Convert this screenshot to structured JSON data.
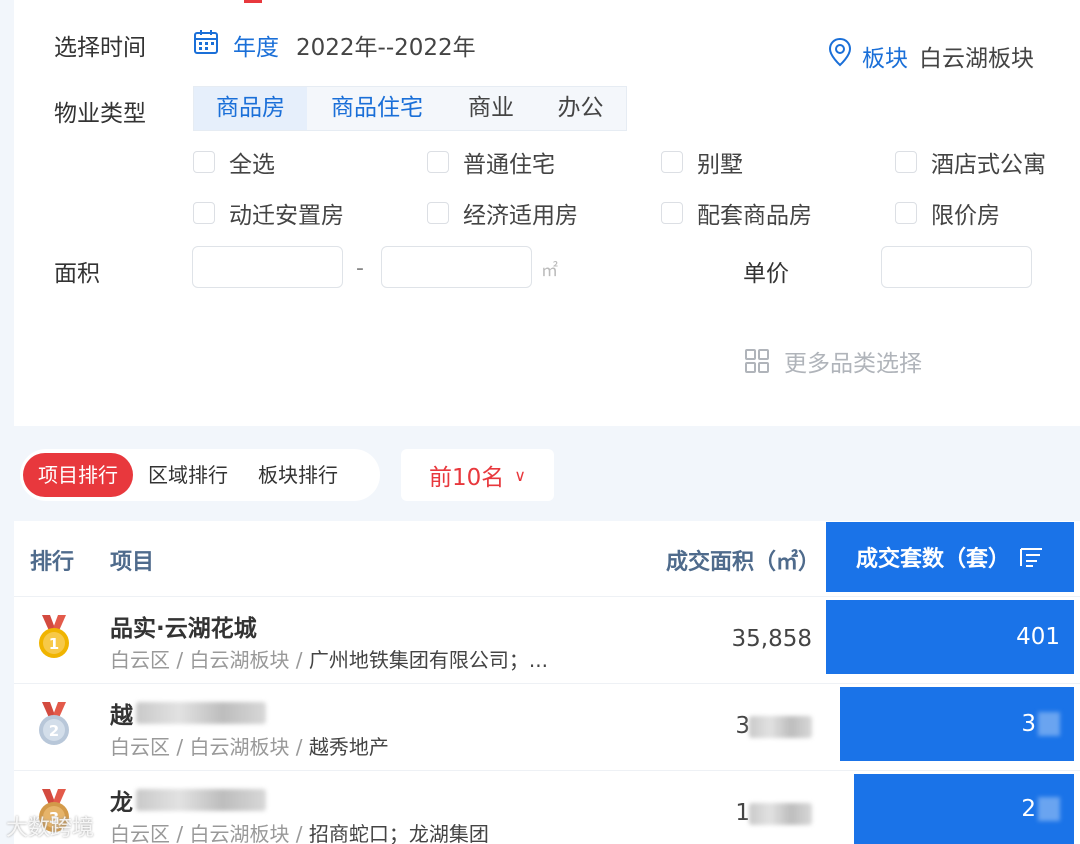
{
  "filters": {
    "time_label": "选择时间",
    "time_mode": "年度",
    "time_range": "2022年--2022年",
    "location_label": "板块",
    "location_value": "白云湖板块",
    "property_type_label": "物业类型",
    "property_tabs": [
      {
        "label": "商品房",
        "active": true
      },
      {
        "label": "商品住宅",
        "active": false
      },
      {
        "label": "商业",
        "active": false
      },
      {
        "label": "办公",
        "active": false
      }
    ],
    "checkboxes": [
      "全选",
      "普通住宅",
      "别墅",
      "酒店式公寓",
      "动迁安置房",
      "经济适用房",
      "配套商品房",
      "限价房"
    ],
    "area_label": "面积",
    "area_min": "",
    "area_max": "",
    "area_separator": "-",
    "area_unit": "㎡",
    "price_label": "单价",
    "price_value": "",
    "more_categories": "更多品类选择"
  },
  "ranking": {
    "tabs": [
      {
        "label": "项目排行",
        "active": true
      },
      {
        "label": "区域排行",
        "active": false
      },
      {
        "label": "板块排行",
        "active": false
      }
    ],
    "top_n": "前10名"
  },
  "table": {
    "headers": {
      "rank": "排行",
      "project": "项目",
      "area": "成交面积（㎡）",
      "units": "成交套数（套）"
    },
    "rows": [
      {
        "rank": 1,
        "name": "品实·云湖花城",
        "district": "白云区",
        "block": "白云湖板块",
        "developer": "广州地铁集团有限公司；...",
        "area": "35,858",
        "units": "401",
        "units_share": 1.0
      },
      {
        "rank": 2,
        "name": "越",
        "district": "白云区",
        "block": "白云湖板块",
        "developer": "越秀地产",
        "area": "3",
        "units": "3",
        "units_share": 0.94
      },
      {
        "rank": 3,
        "name": "龙",
        "district": "白云区",
        "block": "白云湖板块",
        "developer": "招商蛇口；龙湖集团",
        "area": "1",
        "units": "2",
        "units_share": 0.88
      }
    ]
  },
  "colors": {
    "accent": "#1a73e8",
    "red": "#e8383d",
    "gold": "#f0b400",
    "silver": "#b8c7d9",
    "bronze": "#d39a4a"
  },
  "watermark": "大数跨境"
}
